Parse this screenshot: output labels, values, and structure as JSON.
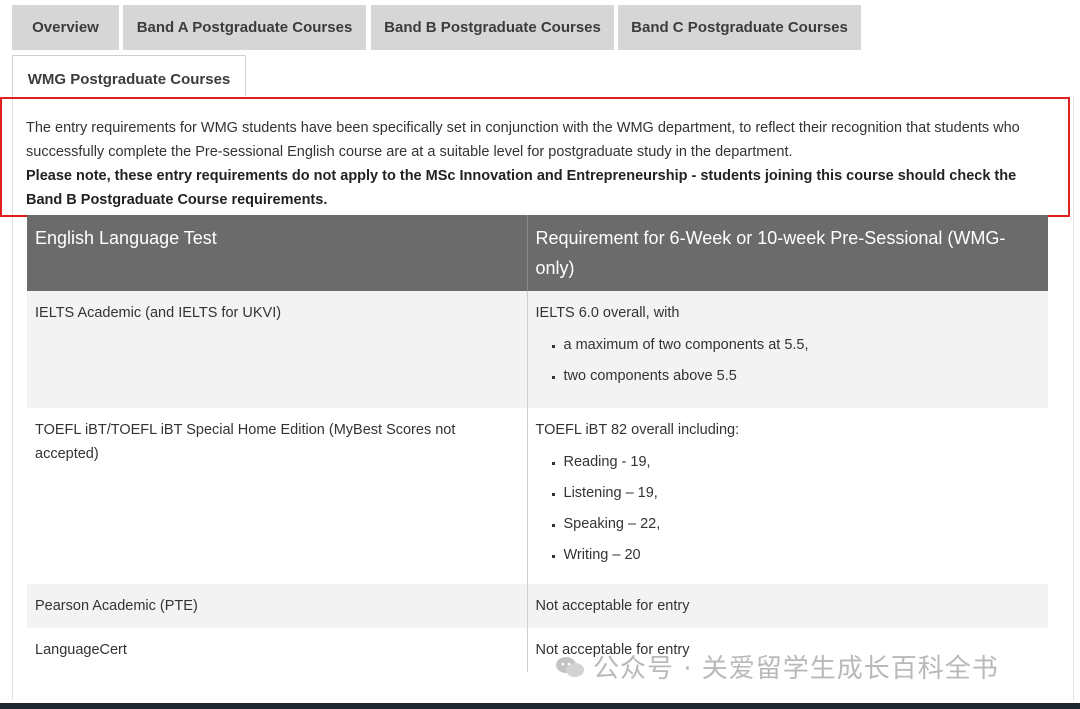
{
  "tabs": [
    {
      "label": "Overview"
    },
    {
      "label": "Band A Postgraduate Courses"
    },
    {
      "label": "Band B Postgraduate Courses"
    },
    {
      "label": "Band C Postgraduate Courses"
    },
    {
      "label": "WMG Postgraduate Courses"
    }
  ],
  "intro": {
    "paragraph": "The entry requirements for WMG students have been specifically set in conjunction with the WMG department, to reflect their recognition that students who successfully complete the Pre-sessional English course are at a suitable level for postgraduate study in the department.",
    "note": "Please note, these entry requirements do not apply to the MSc Innovation and Entrepreneurship - students joining this course should check the Band B Postgraduate Course requirements."
  },
  "table": {
    "headers": [
      "English Language Test",
      "Requirement for 6-Week or 10-week Pre-Sessional (WMG-only)"
    ],
    "rows": [
      {
        "test": "IELTS Academic (and IELTS for UKVI)",
        "requirement": "IELTS 6.0 overall, with",
        "bullets": [
          "a maximum of two components at 5.5,",
          "two components above 5.5"
        ]
      },
      {
        "test": "TOEFL iBT/TOEFL iBT Special Home Edition (MyBest Scores not accepted)",
        "requirement": "TOEFL iBT 82 overall including:",
        "bullets": [
          "Reading - 19,",
          "Listening – 19,",
          "Speaking – 22,",
          "Writing – 20"
        ]
      },
      {
        "test": "Pearson Academic (PTE)",
        "requirement": "Not acceptable for entry"
      },
      {
        "test": "LanguageCert",
        "requirement": "Not acceptable for entry"
      }
    ]
  },
  "watermark": {
    "text": "公众号 · 关爱留学生成长百科全书",
    "icon": "wechat-icon"
  }
}
